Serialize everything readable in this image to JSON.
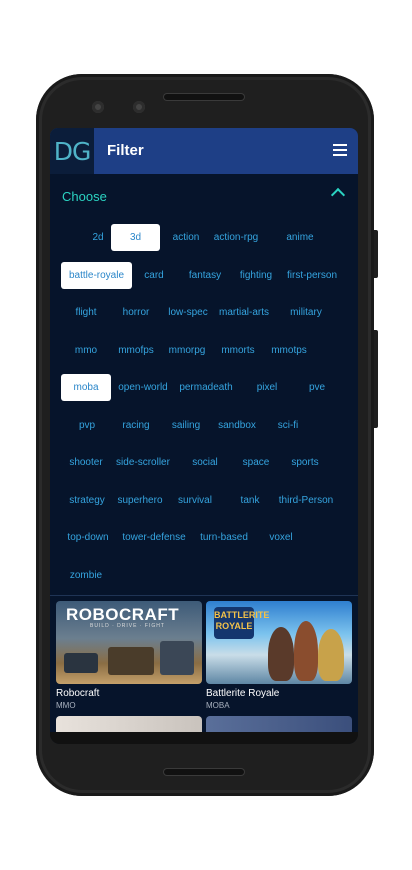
{
  "header": {
    "logo_text": "DG",
    "title": "Filter"
  },
  "filter": {
    "section_label": "Choose"
  },
  "tags": [
    {
      "label": "2d",
      "selected": false
    },
    {
      "label": "3d",
      "selected": true
    },
    {
      "label": "action",
      "selected": false
    },
    {
      "label": "action-rpg",
      "selected": false
    },
    {
      "label": "anime",
      "selected": false
    },
    {
      "label": "battle-royale",
      "selected": true
    },
    {
      "label": "card",
      "selected": false
    },
    {
      "label": "fantasy",
      "selected": false
    },
    {
      "label": "fighting",
      "selected": false
    },
    {
      "label": "first-person",
      "selected": false
    },
    {
      "label": "flight",
      "selected": false
    },
    {
      "label": "horror",
      "selected": false
    },
    {
      "label": "low-spec",
      "selected": false
    },
    {
      "label": "martial-arts",
      "selected": false
    },
    {
      "label": "military",
      "selected": false
    },
    {
      "label": "mmo",
      "selected": false
    },
    {
      "label": "mmofps",
      "selected": false
    },
    {
      "label": "mmorpg",
      "selected": false
    },
    {
      "label": "mmorts",
      "selected": false
    },
    {
      "label": "mmotps",
      "selected": false
    },
    {
      "label": "moba",
      "selected": true
    },
    {
      "label": "open-world",
      "selected": false
    },
    {
      "label": "permadeath",
      "selected": false
    },
    {
      "label": "pixel",
      "selected": false
    },
    {
      "label": "pve",
      "selected": false
    },
    {
      "label": "pvp",
      "selected": false
    },
    {
      "label": "racing",
      "selected": false
    },
    {
      "label": "sailing",
      "selected": false
    },
    {
      "label": "sandbox",
      "selected": false
    },
    {
      "label": "sci-fi",
      "selected": false
    },
    {
      "label": "shooter",
      "selected": false
    },
    {
      "label": "side-scroller",
      "selected": false
    },
    {
      "label": "social",
      "selected": false
    },
    {
      "label": "space",
      "selected": false
    },
    {
      "label": "sports",
      "selected": false
    },
    {
      "label": "strategy",
      "selected": false
    },
    {
      "label": "superhero",
      "selected": false
    },
    {
      "label": "survival",
      "selected": false
    },
    {
      "label": "tank",
      "selected": false
    },
    {
      "label": "third-Person",
      "selected": false
    },
    {
      "label": "top-down",
      "selected": false
    },
    {
      "label": "tower-defense",
      "selected": false
    },
    {
      "label": "turn-based",
      "selected": false
    },
    {
      "label": "voxel",
      "selected": false
    },
    {
      "label": "zombie",
      "selected": false
    }
  ],
  "games": [
    {
      "title": "Robocraft",
      "genre": "MMO",
      "art_text": "ROBOCRAFT",
      "art_subtext": "BUILD · DRIVE · FIGHT"
    },
    {
      "title": "Battlerite Royale",
      "genre": "MOBA",
      "art_text": "BATTLERITE ROYALE"
    }
  ],
  "icons": {
    "menu": "hamburger-menu-icon",
    "collapse": "chevron-up-icon"
  },
  "colors": {
    "appbar": "#1e3f86",
    "background": "#06142b",
    "accent": "#2bd3c2",
    "tag_text": "#35a4df",
    "selected_chip": "#ffffff"
  }
}
